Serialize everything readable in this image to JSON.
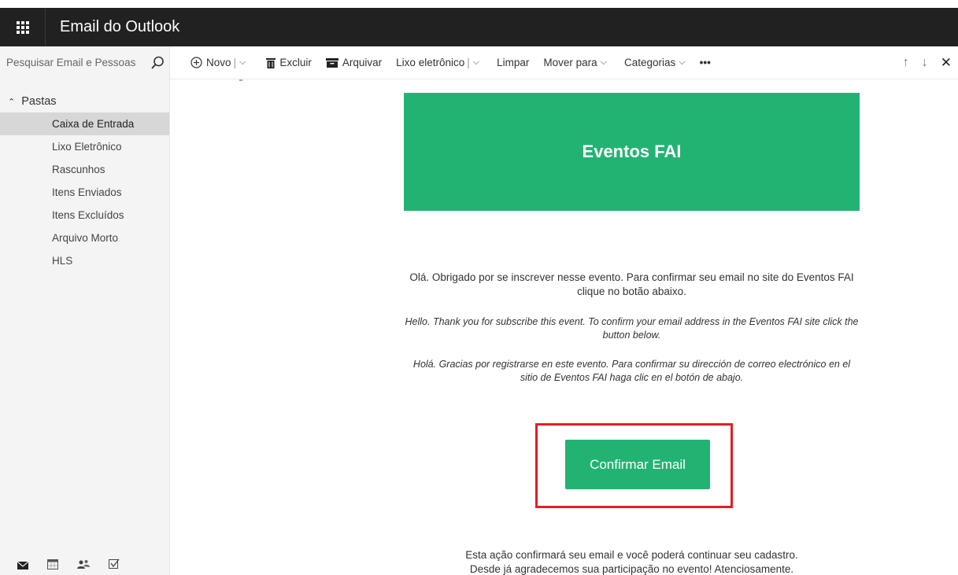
{
  "header": {
    "app_title": "Email do Outlook"
  },
  "search": {
    "placeholder": "Pesquisar Email e Pessoas"
  },
  "toolbar": {
    "new_label": "Novo",
    "delete_label": "Excluir",
    "archive_label": "Arquivar",
    "junk_label": "Lixo eletrônico",
    "sweep_label": "Limpar",
    "move_label": "Mover para",
    "categories_label": "Categorias",
    "more_label": "•••"
  },
  "sidebar": {
    "folders_heading": "Pastas",
    "items": [
      {
        "label": "Caixa de Entrada",
        "active": true
      },
      {
        "label": "Lixo Eletrônico",
        "active": false
      },
      {
        "label": "Rascunhos",
        "active": false
      },
      {
        "label": "Itens Enviados",
        "active": false
      },
      {
        "label": "Itens Excluídos",
        "active": false
      },
      {
        "label": "Arquivo Morto",
        "active": false
      },
      {
        "label": "HLS",
        "active": false
      }
    ]
  },
  "email": {
    "banner_title": "Eventos FAI",
    "body_pt": "Olá. Obrigado por se inscrever nesse evento. Para confirmar seu email no site do Eventos FAI clique no botão abaixo.",
    "body_en": "Hello. Thank you for subscribe this event. To confirm your email address in the Eventos FAI site click the button below.",
    "body_es": "Holá. Gracias por registrarse en este evento. Para confirmar su dirección de correo electrónico en el sitio de Eventos FAI haga clic en el botón de abajo.",
    "confirm_button": "Confirmar Email",
    "footer_line1": "Esta ação confirmará seu email e você poderá continuar seu cadastro.",
    "footer_line2": "Desde já agradecemos sua participação no evento! Atenciosamente."
  },
  "colors": {
    "brand_green": "#22b373",
    "topbar": "#212121",
    "highlight_red": "#e01f26"
  }
}
